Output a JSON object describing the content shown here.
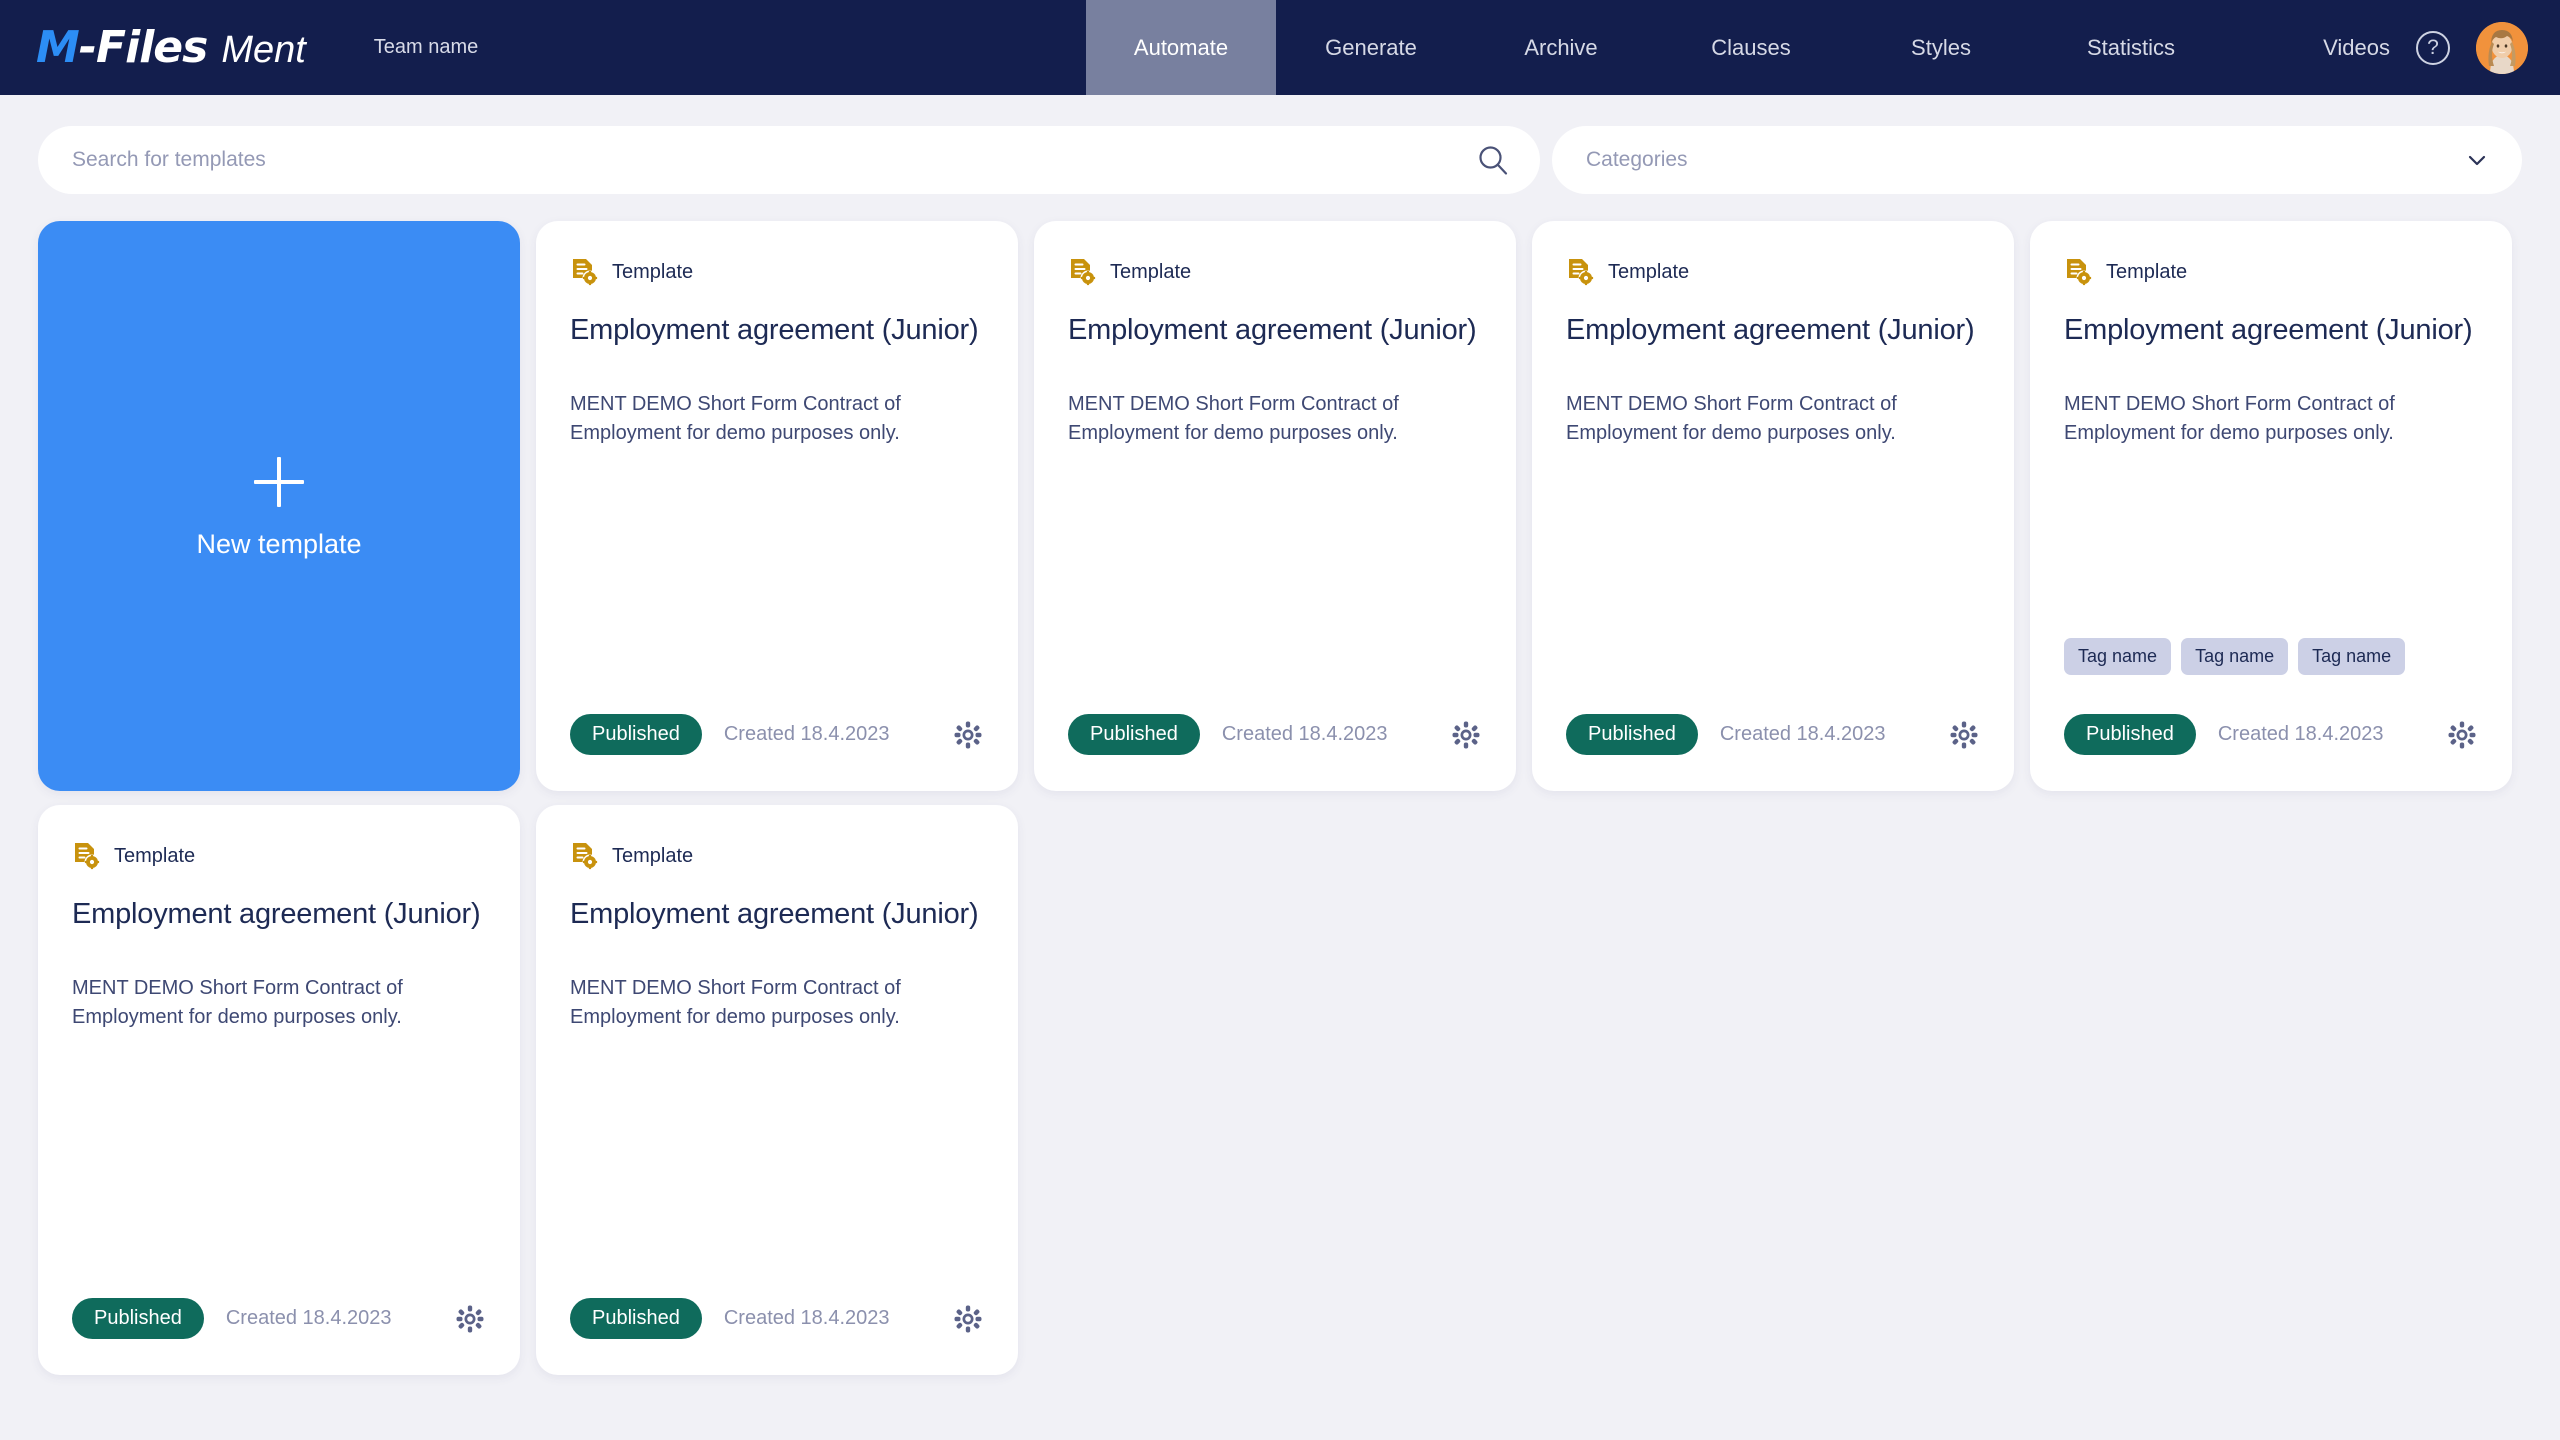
{
  "header": {
    "logo": {
      "brand_m": "M",
      "brand_files": "-Files",
      "product": "Ment"
    },
    "team_name": "Team name",
    "tabs": [
      {
        "label": "Automate",
        "active": true
      },
      {
        "label": "Generate",
        "active": false
      },
      {
        "label": "Archive",
        "active": false
      },
      {
        "label": "Clauses",
        "active": false
      },
      {
        "label": "Styles",
        "active": false
      },
      {
        "label": "Statistics",
        "active": false
      }
    ],
    "videos_label": "Videos",
    "help_glyph": "?",
    "colors": {
      "bar": "#131e4d",
      "active_tab": "#78809f",
      "logo_blue": "#2c8df5"
    }
  },
  "search": {
    "placeholder": "Search for templates",
    "value": "",
    "categories_label": "Categories"
  },
  "new_template_card": {
    "label": "New template",
    "color": "#3b8cf4"
  },
  "cards": [
    {
      "type_label": "Template",
      "title": "Employment agreement (Junior)",
      "description": "MENT DEMO Short Form Contract of Employment for demo purposes only.",
      "status": "Published",
      "created": "Created 18.4.2023",
      "tags": []
    },
    {
      "type_label": "Template",
      "title": "Employment agreement (Junior)",
      "description": "MENT DEMO Short Form Contract of Employment for demo purposes only.",
      "status": "Published",
      "created": "Created 18.4.2023",
      "tags": []
    },
    {
      "type_label": "Template",
      "title": "Employment agreement (Junior)",
      "description": "MENT DEMO Short Form Contract of Employment for demo purposes only.",
      "status": "Published",
      "created": "Created 18.4.2023",
      "tags": []
    },
    {
      "type_label": "Template",
      "title": "Employment agreement (Junior)",
      "description": "MENT DEMO Short Form Contract of Employment for demo purposes only.",
      "status": "Published",
      "created": "Created 18.4.2023",
      "tags": [
        "Tag name",
        "Tag name",
        "Tag name"
      ]
    },
    {
      "type_label": "Template",
      "title": "Employment agreement (Junior)",
      "description": "MENT DEMO Short Form Contract of Employment for demo purposes only.",
      "status": "Published",
      "created": "Created 18.4.2023",
      "tags": []
    },
    {
      "type_label": "Template",
      "title": "Employment agreement (Junior)",
      "description": "MENT DEMO Short Form Contract of Employment for demo purposes only.",
      "status": "Published",
      "created": "Created 18.4.2023",
      "tags": []
    }
  ],
  "colors": {
    "page_background": "#f1f1f6",
    "card_background": "#ffffff",
    "status_green": "#0f6b5c",
    "tag_background": "#ccd0e6",
    "template_icon_gold": "#c8920d",
    "title_navy": "#1d2a54"
  }
}
